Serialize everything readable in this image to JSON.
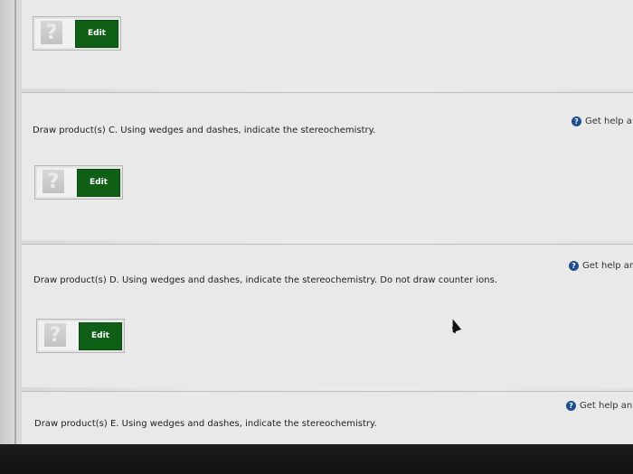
{
  "sections": [
    {
      "prompt": "",
      "help": "",
      "qmark": "?",
      "edit": "Edit"
    },
    {
      "prompt": "Draw product(s) C. Using wedges and dashes, indicate the stereochemistry.",
      "help": "Get help a",
      "qmark": "?",
      "edit": "Edit"
    },
    {
      "prompt": "Draw product(s) D. Using wedges and dashes, indicate the stereochemistry. Do not draw counter ions.",
      "help": "Get help ar",
      "qmark": "?",
      "edit": "Edit"
    },
    {
      "prompt": "Draw product(s) E. Using wedges and dashes, indicate the stereochemistry.",
      "help": "Get help an",
      "qmark": "",
      "edit": ""
    }
  ],
  "help_icon": "question-circle-icon",
  "colors": {
    "edit_button": "#0f5f16",
    "help_icon": "#1f4d8f"
  }
}
